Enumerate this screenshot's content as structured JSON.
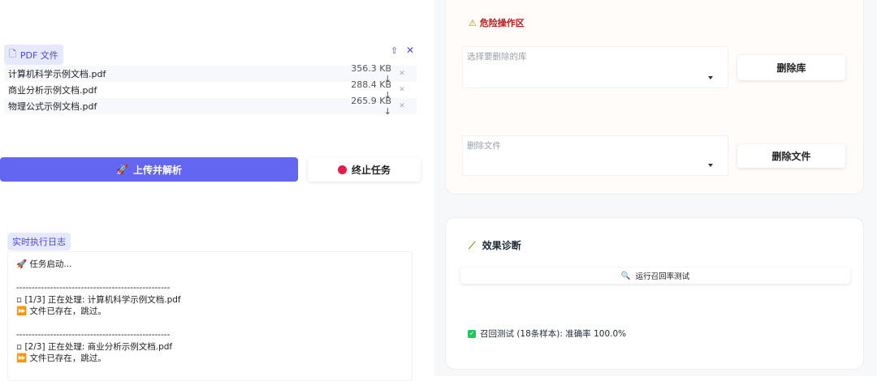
{
  "upload": {
    "label": "PDF 文件",
    "files": [
      {
        "name": "计算机科学示例文档.pdf",
        "size": "356.3 KB"
      },
      {
        "name": "商业分析示例文档.pdf",
        "size": "288.4 KB"
      },
      {
        "name": "物理公式示例文档.pdf",
        "size": "265.9 KB"
      }
    ]
  },
  "actions": {
    "parse": "上传并解析",
    "stop": "终止任务"
  },
  "log": {
    "label": "实时执行日志",
    "lines": [
      "🚀 任务启动...",
      "",
      "--------------------------------------------------",
      "▫ [1/3] 正在处理: 计算机科学示例文档.pdf",
      "⏩ 文件已存在，跳过。",
      "",
      "--------------------------------------------------",
      "▫ [2/3] 正在处理: 商业分析示例文档.pdf",
      "⏩ 文件已存在，跳过。"
    ]
  },
  "danger": {
    "title": "危险操作区",
    "select_lib_label": "选择要删除的库",
    "delete_lib": "删除库",
    "select_file_label": "删除文件",
    "delete_file": "删除文件"
  },
  "diag": {
    "title": "效果诊断",
    "run": "运行召回率测试",
    "result": "召回测试 (18条样本): 准确率 100.0%"
  }
}
